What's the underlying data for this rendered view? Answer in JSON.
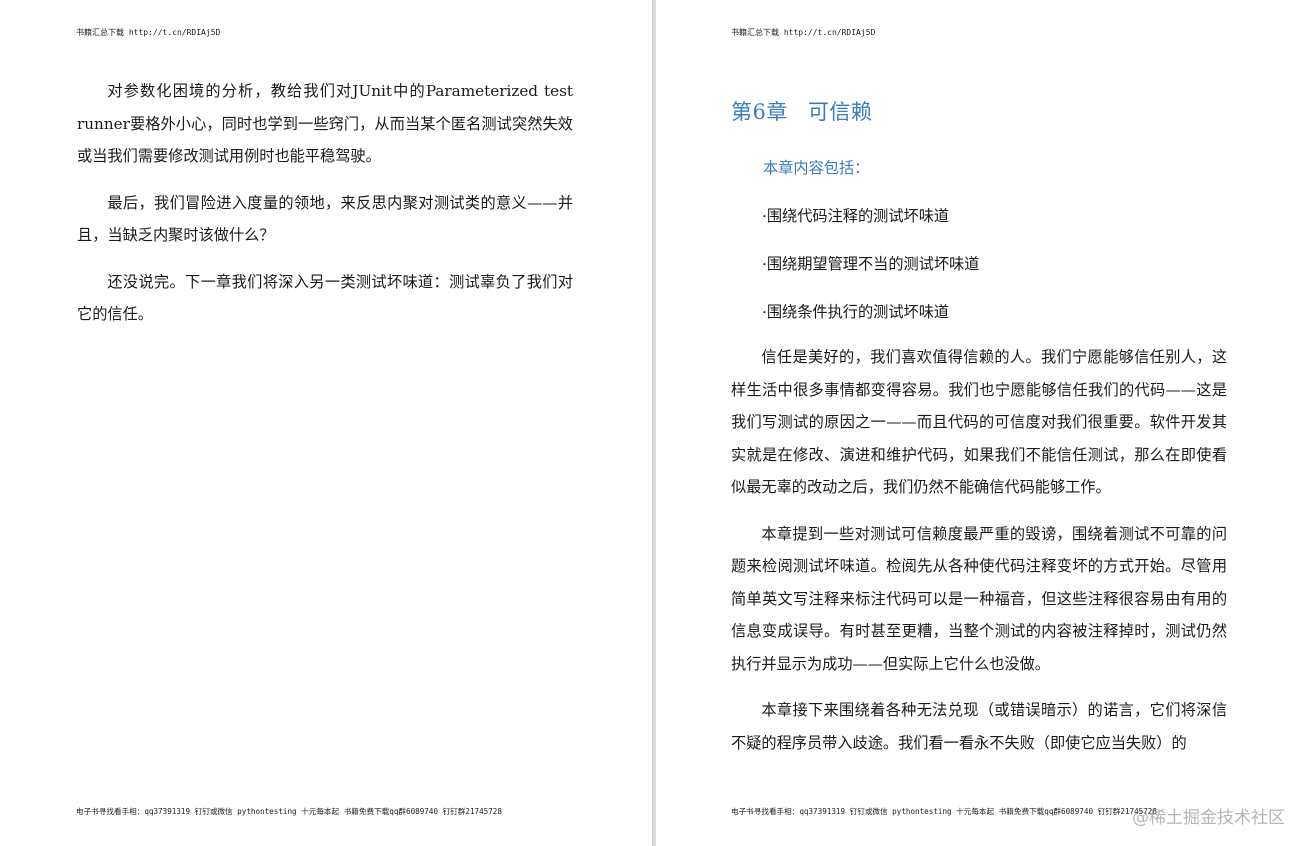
{
  "left_page": {
    "header": "书籍汇总下载 http://t.cn/RDIAj5D",
    "paragraphs": [
      "对参数化困境的分析，教给我们对JUnit中的Parameterized test runner要格外小心，同时也学到一些窍门，从而当某个匿名测试突然失效或当我们需要修改测试用例时也能平稳驾驶。",
      "最后，我们冒险进入度量的领地，来反思内聚对测试类的意义——并且，当缺乏内聚时该做什么？",
      "还没说完。下一章我们将深入另一类测试坏味道：测试辜负了我们对它的信任。"
    ],
    "footer": "电子书寻找看手相：qq37391319 钉钉或微信 pythontesting 十元每本起 书籍免费下载qq群6089740 钉钉群21745728"
  },
  "right_page": {
    "header": "书籍汇总下载 http://t.cn/RDIAj5D",
    "chapter_number": "第6章",
    "chapter_title": "可信赖",
    "contents_heading": "本章内容包括：",
    "bullets": [
      "·围绕代码注释的测试坏味道",
      "·围绕期望管理不当的测试坏味道",
      "·围绕条件执行的测试坏味道"
    ],
    "paragraphs": [
      "信任是美好的，我们喜欢值得信赖的人。我们宁愿能够信任别人，这样生活中很多事情都变得容易。我们也宁愿能够信任我们的代码——这是我们写测试的原因之一——而且代码的可信度对我们很重要。软件开发其实就是在修改、演进和维护代码，如果我们不能信任测试，那么在即使看似最无辜的改动之后，我们仍然不能确信代码能够工作。",
      "本章提到一些对测试可信赖度最严重的毁谤，围绕着测试不可靠的问题来检阅测试坏味道。检阅先从各种使代码注释变坏的方式开始。尽管用简单英文写注释来标注代码可以是一种福音，但这些注释很容易由有用的信息变成误导。有时甚至更糟，当整个测试的内容被注释掉时，测试仍然执行并显示为成功——但实际上它什么也没做。",
      "本章接下来围绕着各种无法兑现（或错误暗示）的诺言，它们将深信不疑的程序员带入歧途。我们看一看永不失败（即使它应当失败）的"
    ],
    "footer": "电子书寻找看手相：qq37391319 钉钉或微信 pythontesting 十元每本起 书籍免费下载qq群6089740 钉钉群21745728",
    "watermark": "@稀土掘金技术社区"
  },
  "colors": {
    "chapter_blue": "#3a7bbf",
    "text": "#1a1a1a",
    "background": "#ffffff"
  }
}
